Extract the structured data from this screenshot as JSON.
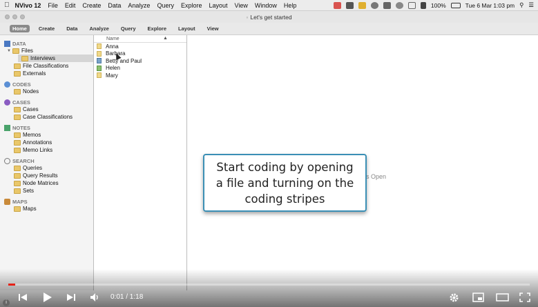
{
  "menubar": {
    "app": "NVivo 12",
    "items": [
      "File",
      "Edit",
      "Create",
      "Data",
      "Analyze",
      "Query",
      "Explore",
      "Layout",
      "View",
      "Window",
      "Help"
    ],
    "battery": "100%",
    "clock": "Tue 6 Mar  1:03 pm"
  },
  "window": {
    "title": "Let's get started"
  },
  "ribbon": {
    "tabs": [
      "Home",
      "Create",
      "Data",
      "Analyze",
      "Query",
      "Explore",
      "Layout",
      "View"
    ]
  },
  "nav": {
    "data_header": "DATA",
    "files": "Files",
    "interviews": "Interviews",
    "file_classifications": "File Classifications",
    "externals": "Externals",
    "codes_header": "CODES",
    "nodes": "Nodes",
    "cases_header": "CASES",
    "cases": "Cases",
    "case_classifications": "Case Classifications",
    "notes_header": "NOTES",
    "memos": "Memos",
    "annotations": "Annotations",
    "memo_links": "Memo Links",
    "search_header": "SEARCH",
    "queries": "Queries",
    "query_results": "Query Results",
    "node_matrices": "Node Matrices",
    "sets": "Sets",
    "maps_header": "MAPS",
    "maps": "Maps"
  },
  "list": {
    "column_name": "Name",
    "rows": [
      "Anna",
      "Barbara",
      "Betty and Paul",
      "Helen",
      "Mary"
    ]
  },
  "detail": {
    "peek_text": "s Open"
  },
  "callout": {
    "text": "Start coding by opening a file and turning on the coding stripes"
  },
  "video": {
    "time": "0:01 / 1:18",
    "progress": 0.013
  },
  "colors": {
    "callout_border": "#3a8fb5",
    "progress_played": "#e62117"
  }
}
